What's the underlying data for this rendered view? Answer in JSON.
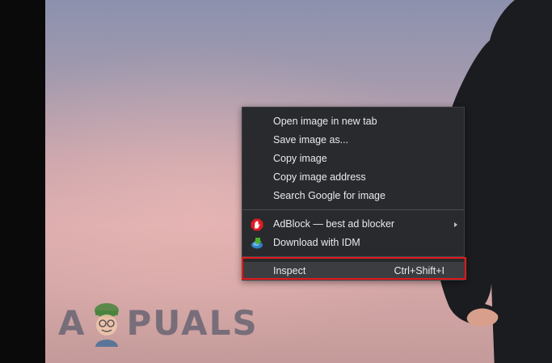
{
  "context_menu": {
    "group1": [
      {
        "label": "Open image in new tab",
        "name": "menu-item-open-image-new-tab"
      },
      {
        "label": "Save image as...",
        "name": "menu-item-save-image-as"
      },
      {
        "label": "Copy image",
        "name": "menu-item-copy-image"
      },
      {
        "label": "Copy image address",
        "name": "menu-item-copy-image-address"
      },
      {
        "label": "Search Google for image",
        "name": "menu-item-search-google-for-image"
      }
    ],
    "adblock": {
      "label": "AdBlock — best ad blocker",
      "icon": "adblock-hand-icon",
      "has_submenu": true
    },
    "idm": {
      "label": "Download with IDM",
      "icon": "idm-icon"
    },
    "inspect": {
      "label": "Inspect",
      "shortcut": "Ctrl+Shift+I"
    }
  },
  "watermark": {
    "part1": "A",
    "part2": "PUALS",
    "icon": "appuals-mascot-icon"
  },
  "colors": {
    "menu_background": "#292a2d",
    "menu_text": "#e8eaed",
    "inspect_hover": "#3c3d40",
    "highlight_border": "#e0191b",
    "adblock_red": "#e31b23"
  }
}
